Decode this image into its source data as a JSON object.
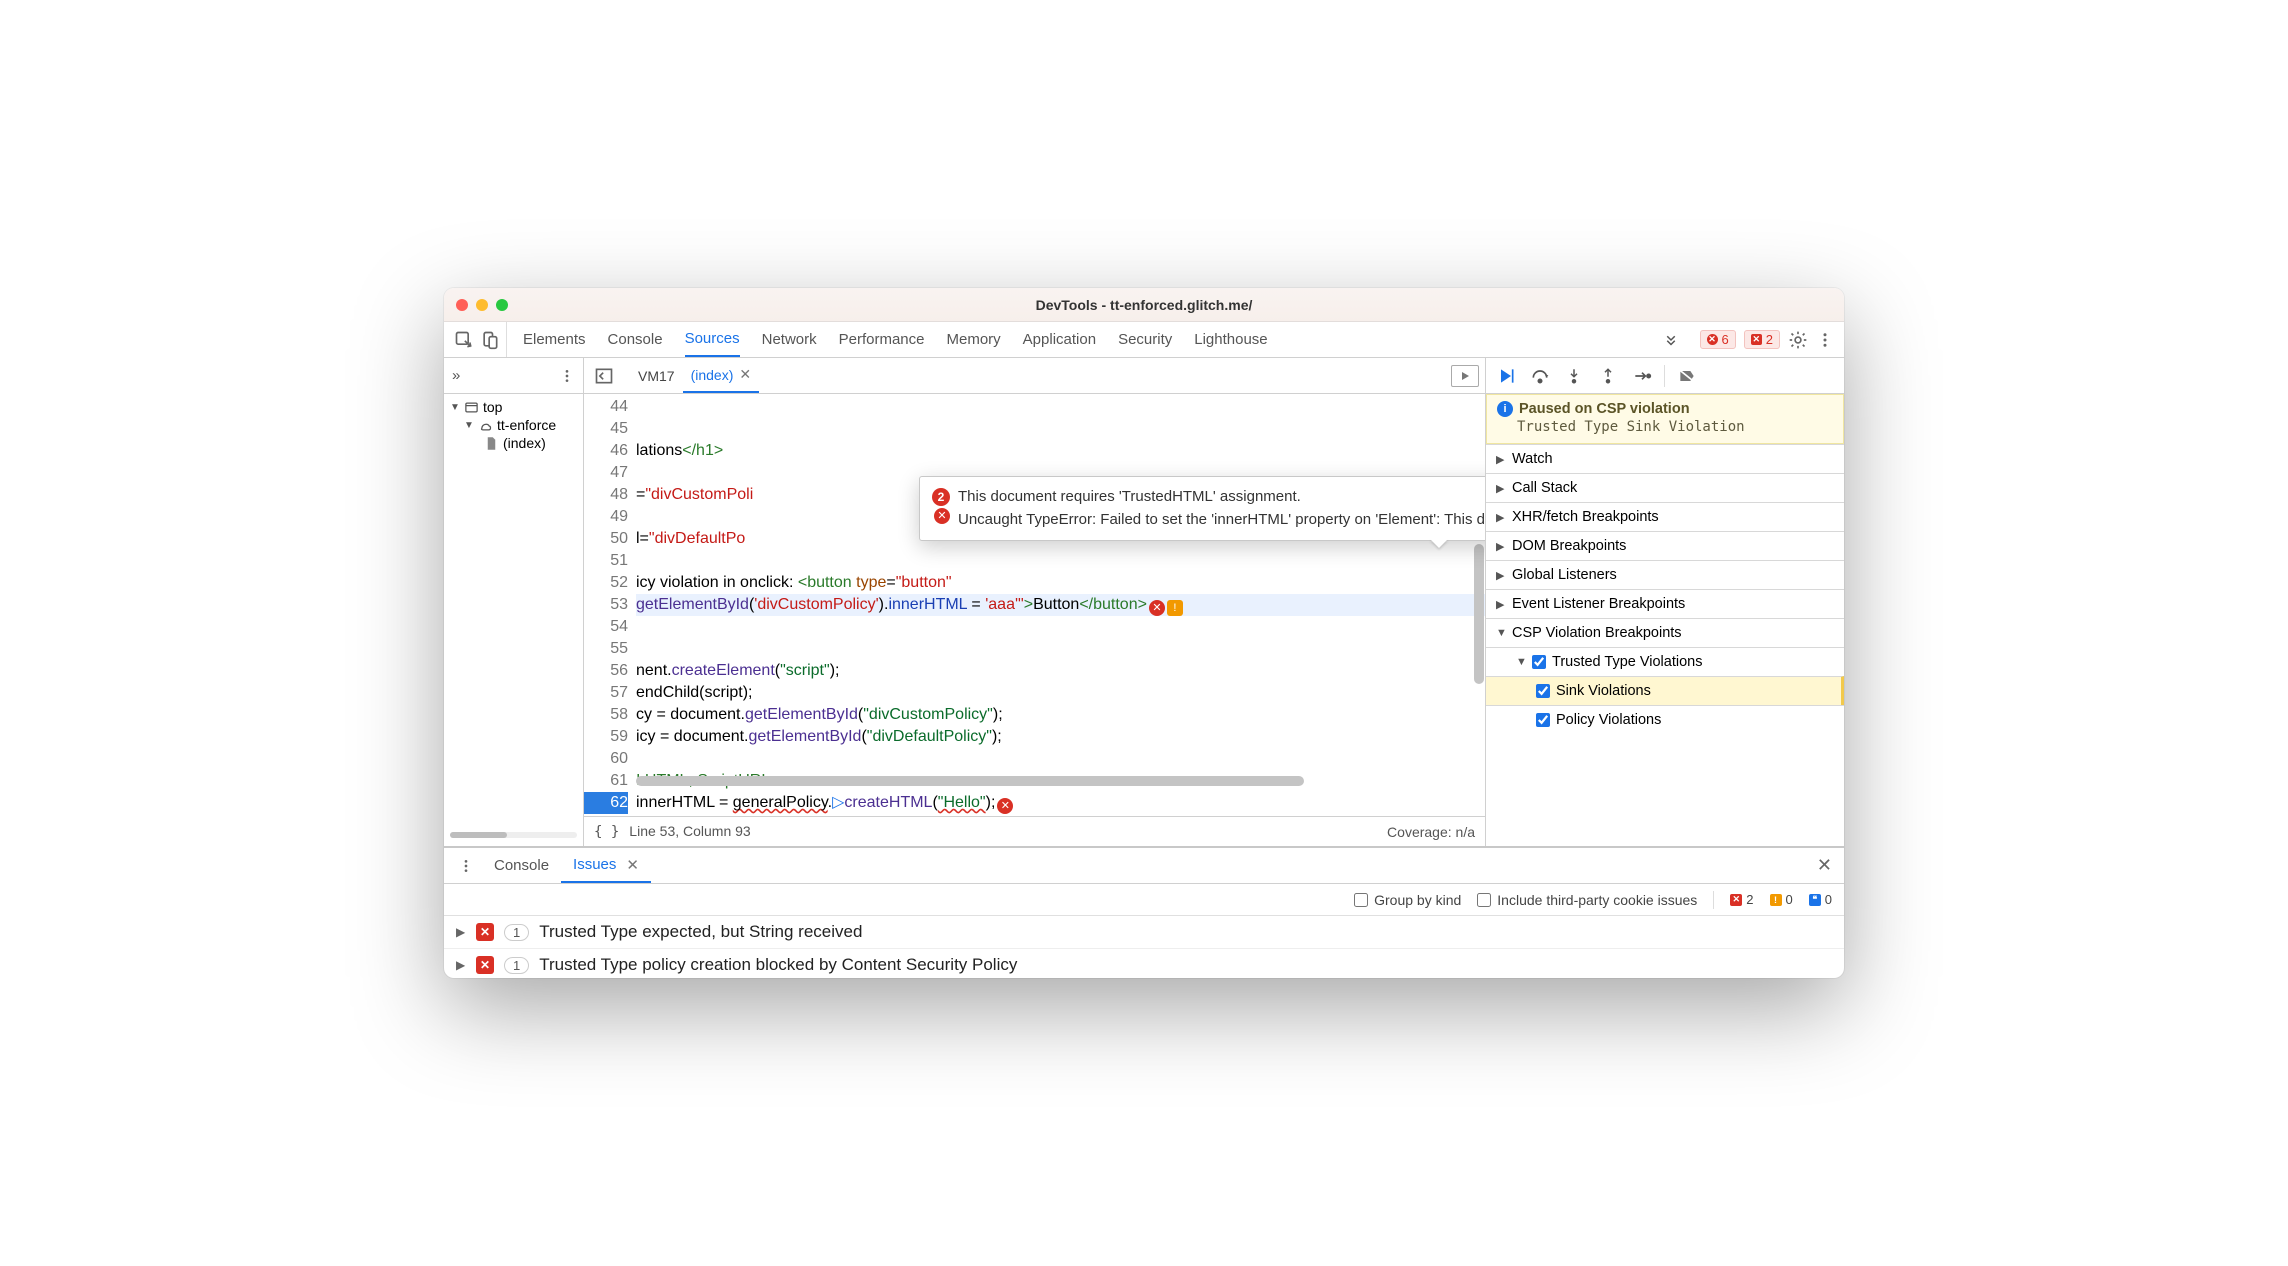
{
  "window": {
    "title": "DevTools - tt-enforced.glitch.me/"
  },
  "tabs": {
    "items": [
      "Elements",
      "Console",
      "Sources",
      "Network",
      "Performance",
      "Memory",
      "Application",
      "Security",
      "Lighthouse"
    ],
    "active_index": 2
  },
  "top_right": {
    "error_count": "6",
    "issue_count": "2"
  },
  "nav": {
    "top_label": "top",
    "origin_label": "tt-enforce",
    "file_label": "(index)"
  },
  "file_tabs": {
    "items": [
      "VM17",
      "(index)"
    ],
    "active_index": 1
  },
  "code": {
    "first_line": 44,
    "lines": [
      {
        "n": 44,
        "html": ""
      },
      {
        "n": 45,
        "html": ""
      },
      {
        "n": 46,
        "html": "lations<span class='tok-tag'>&lt;/h1&gt;</span>"
      },
      {
        "n": 47,
        "html": ""
      },
      {
        "n": 48,
        "html": "=<span class='tok-str'>\"divCustomPoli</span>"
      },
      {
        "n": 49,
        "html": ""
      },
      {
        "n": 50,
        "html": "l=<span class='tok-str'>\"divDefaultPo</span>"
      },
      {
        "n": 51,
        "html": ""
      },
      {
        "n": 52,
        "html": "icy violation in onclick: <span class='tok-tag'>&lt;button</span> <span class='tok-attr'>type</span>=<span class='tok-str'>\"button\"</span>"
      },
      {
        "n": 53,
        "html": "<span class='tok-fn'>getElementById</span>(<span class='tok-str'>'divCustomPolicy'</span>).<span class='tok-blue'>innerHTML</span> = <span class='tok-str'>'aaa'</span><span class='tok-str'>\"</span><span class='tok-tag'>&gt;</span>Button<span class='tok-tag'>&lt;/button&gt;</span><span class='err-dot'>✕</span><span class='warn-dot'>!</span>",
        "hl": "exec"
      },
      {
        "n": 54,
        "html": ""
      },
      {
        "n": 55,
        "html": ""
      },
      {
        "n": 56,
        "html": "nent.<span class='tok-fn'>createElement</span>(<span class='tok-str2'>\"script\"</span>);"
      },
      {
        "n": 57,
        "html": "endChild(script);"
      },
      {
        "n": 58,
        "html": "cy = document.<span class='tok-fn'>getElementById</span>(<span class='tok-str2'>\"divCustomPolicy\"</span>);"
      },
      {
        "n": 59,
        "html": "icy = document.<span class='tok-fn'>getElementById</span>(<span class='tok-str2'>\"divDefaultPolicy\"</span>);"
      },
      {
        "n": 60,
        "html": ""
      },
      {
        "n": 61,
        "html": "<span class='tok-com'>! HTML, ScriptURL</span>"
      },
      {
        "n": 62,
        "html": "innerHTML = <span class='wavy'>generalPolicy</span>.<span style='color:#1a73e8'>▷</span><span class='tok-fn'>createHTML</span>(<span class='wavy tok-str2'>\"Hello\"</span>);<span class='err-dot'>✕</span>",
        "bp": true
      }
    ]
  },
  "tooltip": {
    "count": "2",
    "msg1": "This document requires 'TrustedHTML' assignment.",
    "msg2": "Uncaught TypeError: Failed to set the 'innerHTML' property on 'Element': This document requires 'TrustedHTML' assignment."
  },
  "status": {
    "cursor": "Line 53, Column 93",
    "coverage": "Coverage: n/a"
  },
  "debug": {
    "paused_title": "Paused on CSP violation",
    "paused_sub": "Trusted Type Sink Violation",
    "watch": "Watch",
    "callstack": "Call Stack",
    "xhr": "XHR/fetch Breakpoints",
    "dom": "DOM Breakpoints",
    "global": "Global Listeners",
    "event": "Event Listener Breakpoints",
    "csp": "CSP Violation Breakpoints",
    "tt": "Trusted Type Violations",
    "sink": "Sink Violations",
    "policy_v": "Policy Violations"
  },
  "drawer": {
    "tabs": [
      "Console",
      "Issues"
    ],
    "active_index": 1,
    "group_by_kind": "Group by kind",
    "third_party": "Include third-party cookie issues",
    "badges": {
      "red": "2",
      "yellow": "0",
      "blue": "0"
    },
    "issues": [
      {
        "count": "1",
        "text": "Trusted Type expected, but String received"
      },
      {
        "count": "1",
        "text": "Trusted Type policy creation blocked by Content Security Policy"
      }
    ]
  }
}
